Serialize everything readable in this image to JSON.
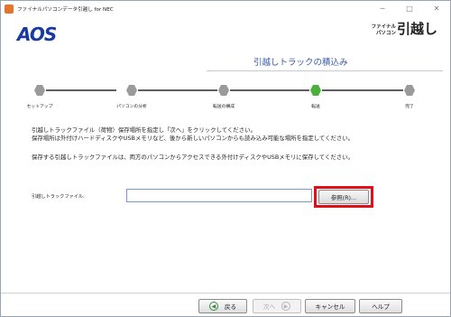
{
  "window": {
    "title": "ファイナルパソコンデータ引越し for NEC",
    "minimize_glyph": "─",
    "maximize_glyph": "□",
    "close_glyph": "✕"
  },
  "header": {
    "logo_left": "AOS",
    "logo_right_small_1": "ファイナル",
    "logo_right_small_2": "パソコン",
    "logo_right_big": "引越し",
    "page_title": "引越しトラックの積込み"
  },
  "steps": [
    {
      "label": "セットアップ",
      "active": false
    },
    {
      "label": "パソコンの分析",
      "active": false
    },
    {
      "label": "転送の構成",
      "active": false
    },
    {
      "label": "転送",
      "active": true
    },
    {
      "label": "完了",
      "active": false
    }
  ],
  "instructions": {
    "line1": "引越しトラックファイル（荷物）保存場所を指定し「次へ」をクリックしてください。",
    "line2": "保存場所は外付けハードディスクやUSBメモリなど、後から新しいパソコンからも読み込み可能な場所を指定してください。",
    "line3": "保存する引越しトラックファイルは、両方のパソコンからアクセスできる外付けディスクやUSBメモリに保存してください。"
  },
  "field": {
    "label": "引越しトラックファイル:",
    "value": "",
    "browse_label": "参照(R)..."
  },
  "buttons": {
    "back": "戻る",
    "next": "次へ",
    "cancel": "キャンセル",
    "help": "ヘルプ"
  },
  "colors": {
    "accent": "#3a5aa8",
    "step_active": "#4caf3c",
    "step_inactive": "#9a9a9a",
    "highlight": "#e0101a"
  }
}
